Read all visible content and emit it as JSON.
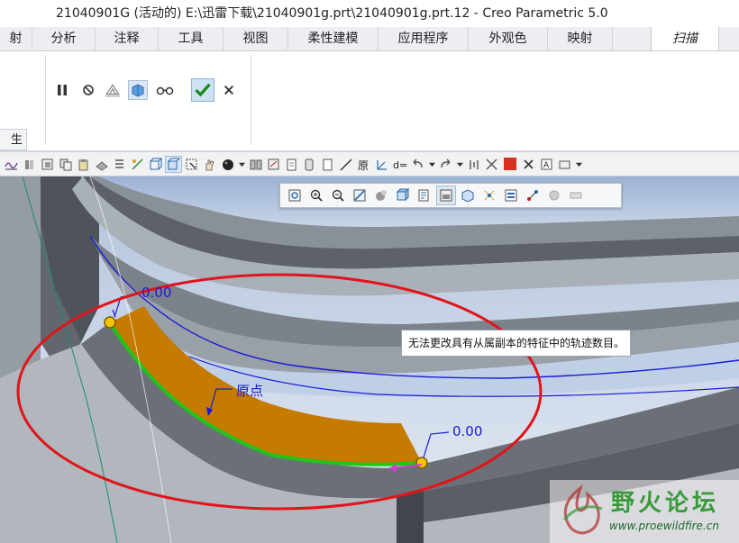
{
  "window": {
    "title": "21040901G (活动的) E:\\迅雷下载\\21040901g.prt\\21040901g.prt.12 - Creo Parametric 5.0"
  },
  "tabs": [
    {
      "label": "射",
      "w": 36
    },
    {
      "label": "分析",
      "w": 70
    },
    {
      "label": "注释",
      "w": 70
    },
    {
      "label": "工具",
      "w": 72
    },
    {
      "label": "视图",
      "w": 72
    },
    {
      "label": "柔性建模",
      "w": 100
    },
    {
      "label": "应用程序",
      "w": 100
    },
    {
      "label": "外观色",
      "w": 88
    },
    {
      "label": "映射",
      "w": 72
    },
    {
      "label": "扫描",
      "w": 76,
      "active": true
    }
  ],
  "left_panel": {
    "tab_label": "生"
  },
  "viewport": {
    "tooltip": "无法更改具有从属副本的特征中的轨迹数目。",
    "dim_left": "0.00",
    "dim_right": "0.00",
    "origin_label": "原点"
  },
  "watermark": {
    "title": "野火论坛",
    "url": "www.proewildfire.cn"
  },
  "colors": {
    "accent_blue": "#1a1ad8",
    "sweep_fill": "#c57a00",
    "trajectory_green": "#22c41a",
    "annotation_red": "#e0141a"
  }
}
